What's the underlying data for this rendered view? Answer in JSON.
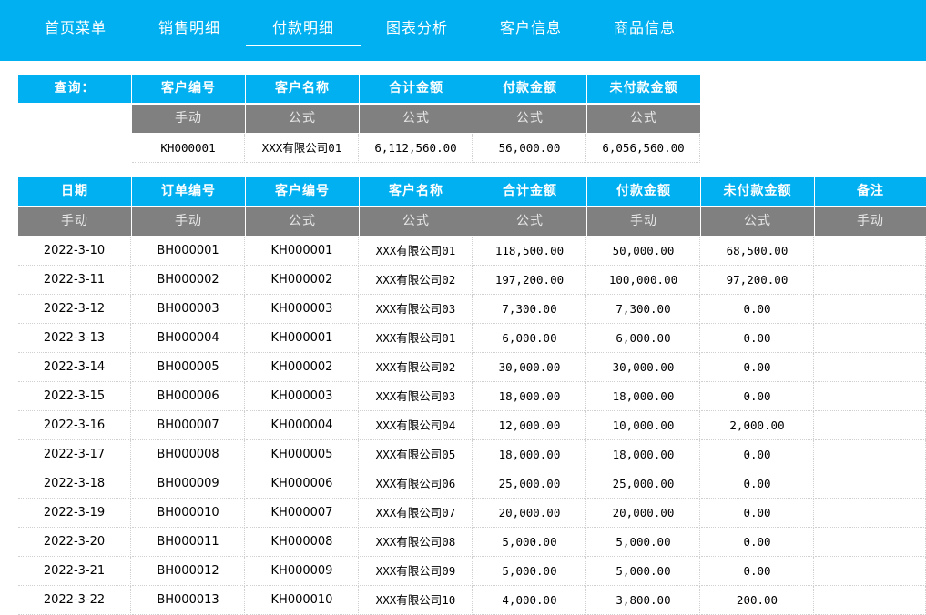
{
  "nav": [
    "首页菜单",
    "销售明细",
    "付款明细",
    "图表分析",
    "客户信息",
    "商品信息"
  ],
  "active_nav": 2,
  "query": {
    "label": "查询：",
    "headers": [
      "客户编号",
      "客户名称",
      "合计金额",
      "付款金额",
      "未付款金额"
    ],
    "subheaders": [
      "手动",
      "公式",
      "公式",
      "公式",
      "公式"
    ],
    "values": [
      "KH000001",
      "XXX有限公司01",
      "6,112,560.00",
      "56,000.00",
      "6,056,560.00"
    ]
  },
  "table": {
    "headers": [
      "日期",
      "订单编号",
      "客户编号",
      "客户名称",
      "合计金额",
      "付款金额",
      "未付款金额",
      "备注"
    ],
    "subheaders": [
      "手动",
      "手动",
      "公式",
      "公式",
      "公式",
      "手动",
      "公式",
      "手动"
    ],
    "rows": [
      [
        "2022-3-10",
        "BH000001",
        "KH000001",
        "XXX有限公司01",
        "118,500.00",
        "50,000.00",
        "68,500.00",
        ""
      ],
      [
        "2022-3-11",
        "BH000002",
        "KH000002",
        "XXX有限公司02",
        "197,200.00",
        "100,000.00",
        "97,200.00",
        ""
      ],
      [
        "2022-3-12",
        "BH000003",
        "KH000003",
        "XXX有限公司03",
        "7,300.00",
        "7,300.00",
        "0.00",
        ""
      ],
      [
        "2022-3-13",
        "BH000004",
        "KH000001",
        "XXX有限公司01",
        "6,000.00",
        "6,000.00",
        "0.00",
        ""
      ],
      [
        "2022-3-14",
        "BH000005",
        "KH000002",
        "XXX有限公司02",
        "30,000.00",
        "30,000.00",
        "0.00",
        ""
      ],
      [
        "2022-3-15",
        "BH000006",
        "KH000003",
        "XXX有限公司03",
        "18,000.00",
        "18,000.00",
        "0.00",
        ""
      ],
      [
        "2022-3-16",
        "BH000007",
        "KH000004",
        "XXX有限公司04",
        "12,000.00",
        "10,000.00",
        "2,000.00",
        ""
      ],
      [
        "2022-3-17",
        "BH000008",
        "KH000005",
        "XXX有限公司05",
        "18,000.00",
        "18,000.00",
        "0.00",
        ""
      ],
      [
        "2022-3-18",
        "BH000009",
        "KH000006",
        "XXX有限公司06",
        "25,000.00",
        "25,000.00",
        "0.00",
        ""
      ],
      [
        "2022-3-19",
        "BH000010",
        "KH000007",
        "XXX有限公司07",
        "20,000.00",
        "20,000.00",
        "0.00",
        ""
      ],
      [
        "2022-3-20",
        "BH000011",
        "KH000008",
        "XXX有限公司08",
        "5,000.00",
        "5,000.00",
        "0.00",
        ""
      ],
      [
        "2022-3-21",
        "BH000012",
        "KH000009",
        "XXX有限公司09",
        "5,000.00",
        "5,000.00",
        "0.00",
        ""
      ],
      [
        "2022-3-22",
        "BH000013",
        "KH000010",
        "XXX有限公司10",
        "4,000.00",
        "3,800.00",
        "200.00",
        ""
      ]
    ]
  }
}
